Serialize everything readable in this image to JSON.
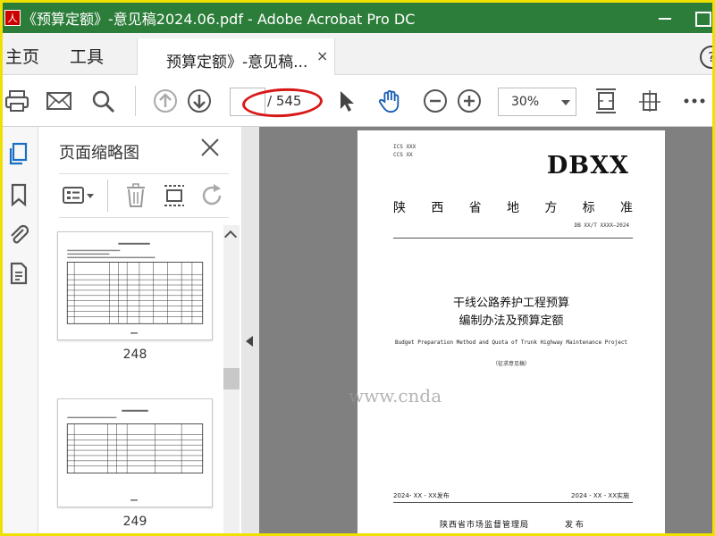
{
  "window": {
    "title": "《预算定额》-意见稿2024.06.pdf - Adobe Acrobat Pro DC",
    "app_icon_glyph": "人",
    "accent": "#2d7d3a",
    "background_frame": "#f0e000"
  },
  "tabs": {
    "home": "主页",
    "tools": "工具",
    "document": "预算定额》-意见稿...",
    "close_glyph": "×",
    "help_glyph": "?"
  },
  "toolbar": {
    "page_current": "",
    "page_total": "/ 545",
    "zoom": "30%",
    "highlight_color": "#d81818"
  },
  "thumbnail_panel": {
    "title": "页面缩略图",
    "thumbnails": [
      {
        "label": "248"
      },
      {
        "label": "249"
      }
    ]
  },
  "document_page": {
    "ics": "ICS  XXX",
    "ccs": "CCS  XX",
    "code": "DBXX",
    "standard_chars": [
      "陕",
      "西",
      "省",
      "地",
      "方",
      "标",
      "准"
    ],
    "number": "DB XX/T XXXX—2024",
    "title_line1": "干线公路养护工程预算",
    "title_line2": "编制办法及预算定额",
    "english_title": "Budget Preparation Method and Quota of Trunk Highway Maintenance Project",
    "draft": "（征求意见稿）",
    "issue_date": "2024- XX - XX发布",
    "implement_date": "2024 - XX - XX实施",
    "issuer": "陕西省市场监督管理局",
    "issue_word": "发 布"
  },
  "watermark": "www.cnda"
}
